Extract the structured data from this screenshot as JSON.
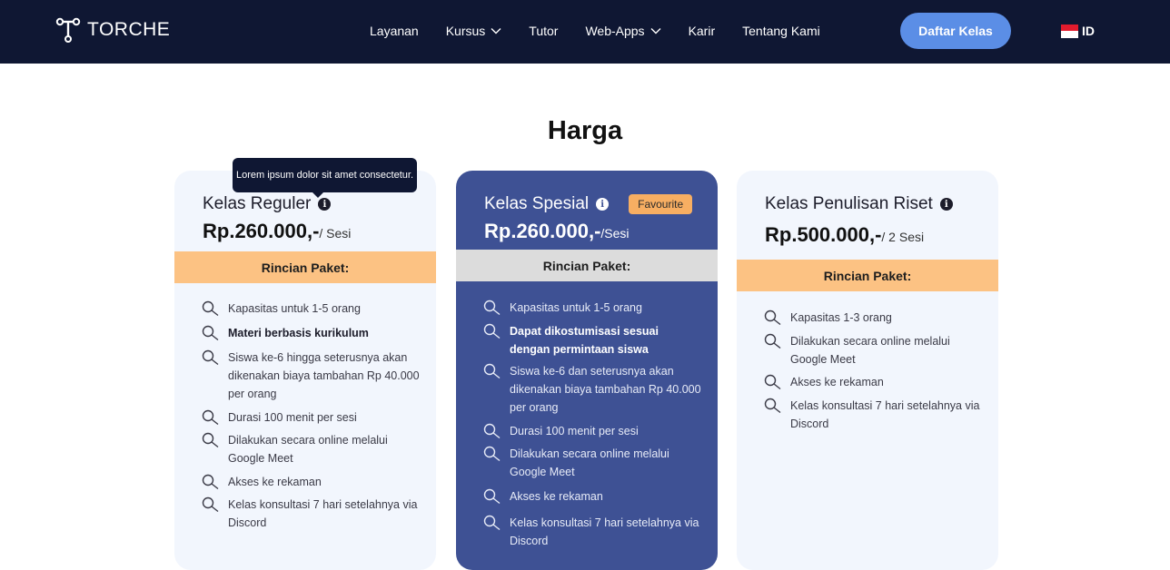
{
  "nav": {
    "brand": "TORCHE",
    "items": [
      {
        "label": "Layanan",
        "dropdown": false
      },
      {
        "label": "Kursus",
        "dropdown": true
      },
      {
        "label": "Tutor",
        "dropdown": false
      },
      {
        "label": "Web-Apps",
        "dropdown": true
      },
      {
        "label": "Karir",
        "dropdown": false
      },
      {
        "label": "Tentang Kami",
        "dropdown": false
      }
    ],
    "cta_label": "Daftar Kelas",
    "lang_label": "ID"
  },
  "section": {
    "title": "Harga"
  },
  "tooltip": {
    "text": "Lorem ipsum dolor sit amet consectetur."
  },
  "cards": [
    {
      "title": "Kelas Reguler",
      "price": "Rp.260.000,-",
      "per": "/ Sesi",
      "rincian_label": "Rincian Paket:",
      "features": [
        {
          "text": "Kapasitas untuk 1-5 orang",
          "bold": false
        },
        {
          "text": "Materi berbasis kurikulum",
          "bold": true
        },
        {
          "text": "Siswa ke-6 hingga seterusnya akan dikenakan biaya tambahan Rp 40.000 per orang",
          "bold": false
        },
        {
          "text": "Durasi 100 menit per sesi",
          "bold": false
        },
        {
          "text": "Dilakukan secara online melalui Google Meet",
          "bold": false
        },
        {
          "text": "Akses ke rekaman",
          "bold": false
        },
        {
          "text": "Kelas konsultasi 7 hari setelahnya via Discord",
          "bold": false
        }
      ]
    },
    {
      "title": "Kelas Spesial",
      "badge": "Favourite",
      "price": "Rp.260.000,-",
      "per": "/Sesi",
      "rincian_label": "Rincian Paket:",
      "features": [
        {
          "text": "Kapasitas untuk 1-5 orang",
          "bold": false
        },
        {
          "text": "Dapat dikostumisasi sesuai dengan permintaan siswa",
          "bold": true
        },
        {
          "text": "Siswa ke-6  dan seterusnya akan dikenakan biaya tambahan Rp 40.000 per orang",
          "bold": false
        },
        {
          "text": "Durasi 100 menit per sesi",
          "bold": false
        },
        {
          "text": "Dilakukan secara online melalui Google Meet",
          "bold": false
        },
        {
          "text": "Akses ke rekaman",
          "bold": false
        },
        {
          "text": "Kelas konsultasi 7 hari setelahnya via Discord",
          "bold": false
        }
      ]
    },
    {
      "title": "Kelas Penulisan Riset",
      "price": "Rp.500.000,-",
      "per": "/ 2 Sesi",
      "rincian_label": "Rincian Paket:",
      "features": [
        {
          "text": "Kapasitas 1-3 orang",
          "bold": false
        },
        {
          "text": "Dilakukan secara online melalui Google Meet",
          "bold": false
        },
        {
          "text": "Akses ke rekaman",
          "bold": false
        },
        {
          "text": "Kelas konsultasi 7 hari setelahnya via Discord",
          "bold": false
        }
      ]
    }
  ],
  "colors": {
    "nav_bg": "#0f1733",
    "cta": "#5b8ee6",
    "card_bg": "#f2f6fd",
    "featured_bg": "#3e5194",
    "rincian_orange": "#fcc283",
    "rincian_grey": "#dcdcdc",
    "badge": "#f7ae62"
  },
  "icons": {
    "feature_bullet": "search-icon",
    "info": "info-icon",
    "dropdown": "chevron-down-icon"
  }
}
